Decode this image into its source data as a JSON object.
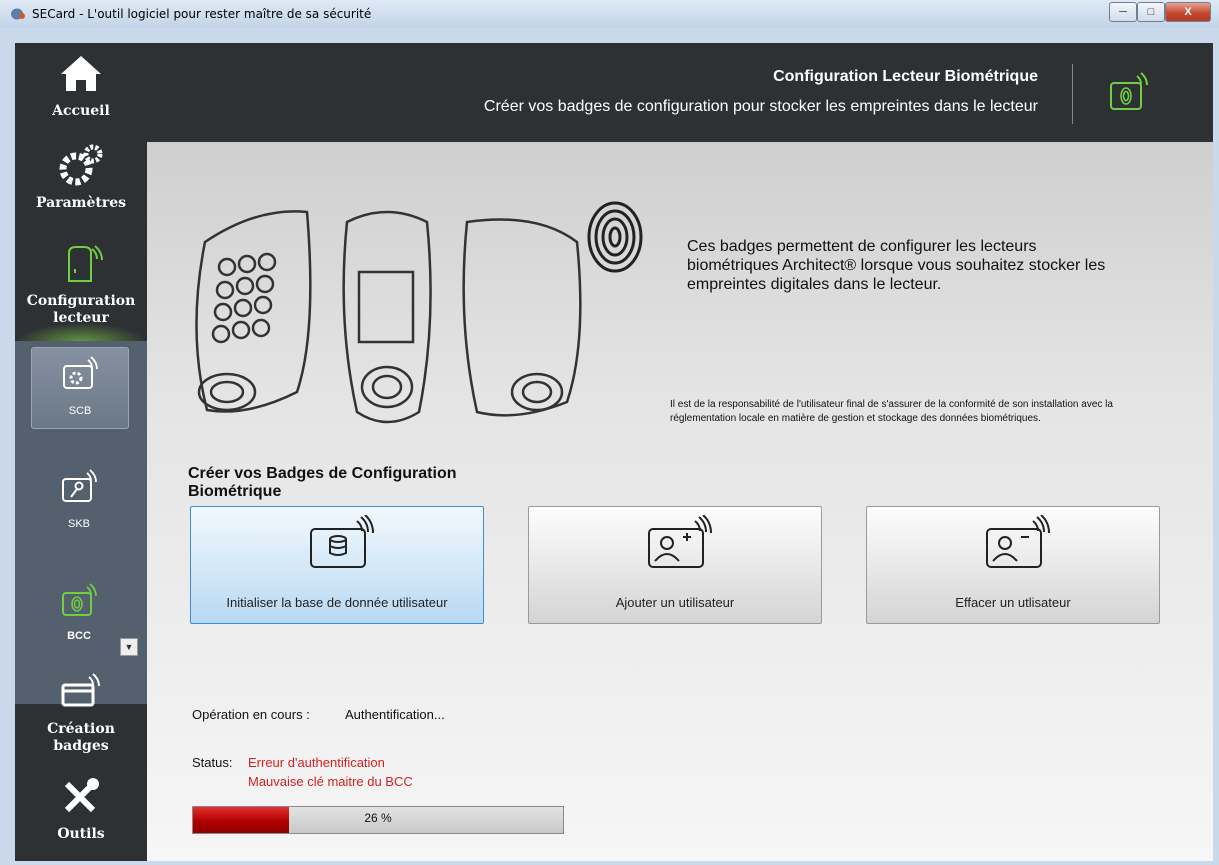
{
  "window": {
    "title": "SECard - L'outil logiciel pour rester maître de sa sécurité",
    "buttons": {
      "minimize": "─",
      "maximize": "□",
      "close": "X"
    }
  },
  "sidebar": {
    "home": {
      "label": "Accueil",
      "icon": "home-icon"
    },
    "settings": {
      "label": "Paramètres",
      "icon": "gears-icon"
    },
    "reader_config": {
      "label": "Configuration lecteur",
      "icon": "reader-icon"
    },
    "sub_items": [
      {
        "label": "SCB",
        "icon": "card-gear-icon",
        "active": true
      },
      {
        "label": "SKB",
        "icon": "card-key-icon",
        "active": false
      },
      {
        "label": "BCC",
        "icon": "card-fingerprint-icon",
        "active": false
      }
    ],
    "badge_creation": {
      "label": "Création badges",
      "icon": "card-reader-icon"
    },
    "tools": {
      "label": "Outils",
      "icon": "tools-icon"
    }
  },
  "header": {
    "title": "Configuration Lecteur Biométrique",
    "subtitle": "Créer vos badges de configuration pour stocker les empreintes dans le lecteur"
  },
  "main": {
    "description": "Ces badges permettent de configurer les lecteurs biométriques Architect® lorsque vous souhaitez stocker les empreintes digitales dans le lecteur.",
    "legal": "Il est de la responsabilité de l'utilisateur final de s'assurer de la conformité de son installation avec la réglementation locale en matière de gestion et stockage des données biométriques.",
    "section_title": "Créer vos Badges de Configuration Biométrique",
    "actions": [
      {
        "label": "Initialiser la base de donnée utilisateur",
        "icon": "database-card-icon",
        "active": true
      },
      {
        "label": "Ajouter un utilisateur",
        "icon": "add-user-card-icon",
        "active": false
      },
      {
        "label": "Effacer un utlisateur",
        "icon": "remove-user-card-icon",
        "active": false
      }
    ],
    "operation_label": "Opération en cours :",
    "operation_value": "Authentification...",
    "status_label": "Status:",
    "status_lines": [
      "Erreur d'authentification",
      "Mauvaise clé maitre du BCC"
    ],
    "progress": {
      "value": 26,
      "text": "26 %"
    }
  },
  "colors": {
    "sidebar_bg": "#2e3134",
    "sub_panel_bg": "#54606d",
    "accent_green": "#6fcf3f",
    "error_red": "#d42020",
    "progress_red": "#c00000"
  }
}
